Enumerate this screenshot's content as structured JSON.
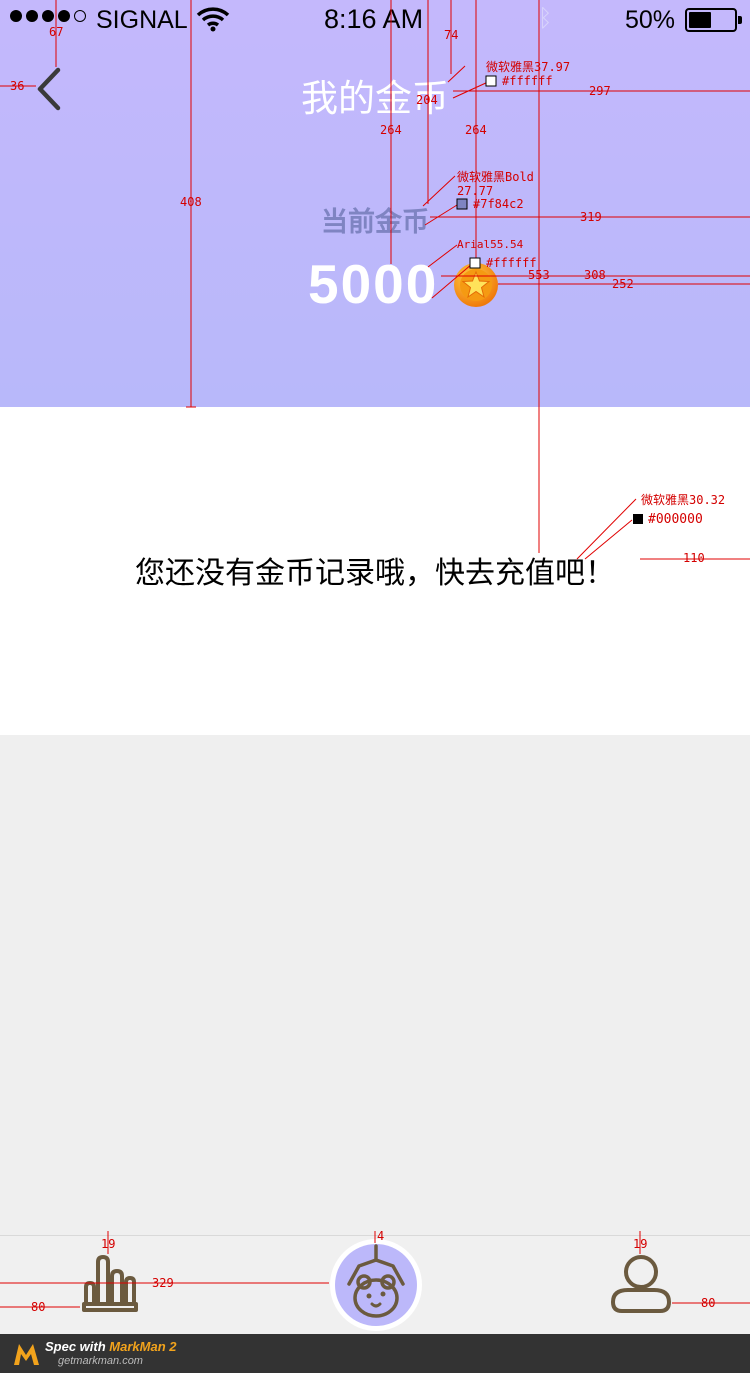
{
  "status_bar": {
    "carrier": "SIGNAL",
    "time": "8:16 AM",
    "battery_percent": "50%",
    "battery_level": 0.5
  },
  "header": {
    "title": "我的金币",
    "current_coins_label": "当前金币",
    "coin_amount": "5000",
    "back_icon": "chevron-left-icon",
    "coin_icon": "star-coin-icon"
  },
  "records": {
    "empty_message": "您还没有金币记录哦，快去充值吧！"
  },
  "tab_bar": {
    "items": [
      {
        "icon": "hand-icon"
      },
      {
        "icon": "bear-claw-icon"
      },
      {
        "icon": "user-icon"
      }
    ]
  },
  "footer": {
    "spec_prefix": "Spec with ",
    "brand": "MarkMan 2",
    "site": "getmarkman.com"
  },
  "annotations": {
    "title_font": "微软雅黑37.97",
    "title_color": "#ffffff",
    "label_font_line1": "微软雅黑Bold",
    "label_font_line2": "27.77",
    "label_color": "#7f84c2",
    "amount_font": "Arial55.54",
    "amount_color": "#ffffff",
    "msg_font": "微软雅黑30.32",
    "msg_color": "#000000",
    "measure_67": "67",
    "measure_36": "36",
    "measure_74": "74",
    "measure_204": "204",
    "measure_297": "297",
    "measure_264a": "264",
    "measure_264b": "264",
    "measure_408": "408",
    "measure_319": "319",
    "measure_553": "553",
    "measure_308": "308",
    "measure_252": "252",
    "measure_110": "110",
    "measure_19a": "19",
    "measure_4": "4",
    "measure_19b": "19",
    "measure_329": "329",
    "measure_80a": "80",
    "measure_80b": "80"
  },
  "colors": {
    "header_top": "#c4b8fc",
    "header_bottom": "#b8b8fa",
    "label": "#7f84c2",
    "tab_icon": "#6b5a3f",
    "spec_red": "#d40000",
    "brand_orange": "#f2a31c"
  }
}
